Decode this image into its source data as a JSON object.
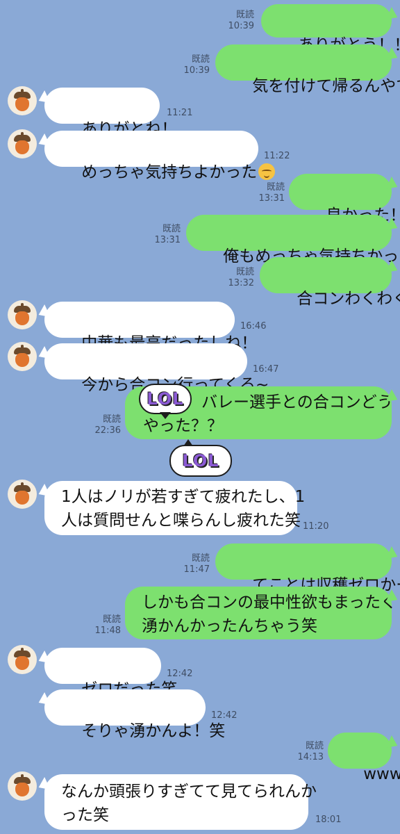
{
  "messages": [
    {
      "side": "me",
      "text": "ありがとう！！",
      "read": "既読",
      "time": "10:39"
    },
    {
      "side": "me",
      "text": "気を付けて帰るんやで",
      "read": "既読",
      "time": "10:39"
    },
    {
      "side": "them",
      "text": "ありがとね！",
      "time": "11:21"
    },
    {
      "side": "them",
      "text": "めっちゃ気持ちよかった",
      "emoji": "relieved-face-icon",
      "time": "11:22"
    },
    {
      "side": "me",
      "text": "良かった！",
      "read": "既読",
      "time": "13:31"
    },
    {
      "side": "me",
      "text": "俺もめっちゃ気持ちかった",
      "read": "既読",
      "time": "13:31"
    },
    {
      "side": "me",
      "text": "合コンわくわく",
      "read": "既読",
      "time": "13:32"
    },
    {
      "side": "them",
      "text": "中華も最高だったしね！",
      "time": "16:46"
    },
    {
      "side": "them",
      "text": "今から合コン行ってくる~",
      "time": "16:47"
    },
    {
      "side": "me",
      "sticker_text": "LOL",
      "text_line1": "バレー選手との合コンどう",
      "text_line2": "やった？？",
      "read": "既読",
      "time": "22:36"
    },
    {
      "side": "them",
      "sticker_text": "LOL",
      "text_line1": "1人はノリが若すぎて疲れたし、1",
      "text_line2": "人は質問せんと喋らんし疲れた笑",
      "time": "11:20"
    },
    {
      "side": "me",
      "text": "てことは収穫ゼロかー",
      "read": "既読",
      "time": "11:47"
    },
    {
      "side": "me",
      "text_line1": "しかも合コンの最中性欲もまったく",
      "text_line2": "湧かんかったんちゃう笑",
      "read": "既読",
      "time": "11:48"
    },
    {
      "side": "them",
      "text": "ゼロだった笑",
      "time": "12:42"
    },
    {
      "side": "them",
      "text": "そりゃ湧かんよ！笑",
      "time": "12:42"
    },
    {
      "side": "me",
      "text": "www",
      "read": "既読",
      "time": "14:13"
    },
    {
      "side": "them",
      "text_line1": "なんか頭張りすぎてて見てられんか",
      "text_line2": "った笑",
      "time": "18:01"
    }
  ],
  "colors": {
    "background": "#8aa9d6",
    "my_bubble": "#7de06f",
    "their_bubble": "#ffffff",
    "sticker_text": "#8b5ad4"
  }
}
